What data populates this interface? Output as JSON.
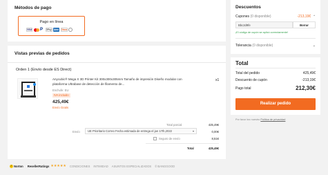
{
  "payment": {
    "title": "Métodos de pago",
    "option_label": "Pago en línea",
    "logos": [
      "VISA",
      "MC",
      "PayPal",
      "GPay",
      "Amex",
      "Discover",
      "Diners"
    ]
  },
  "orders": {
    "title": "Vistas previas de pedidos",
    "order_label": "Orden 1 (Envío desde ES Direct)",
    "product": {
      "name": "Anycubic® Mega X 3D Printer Kit 300x300x305mm Tamaño de impresión Diseño modular con plataforma Ultrabase de detección de filamento de...",
      "sku": "Enchufe: EU",
      "tag": "IVA incluido",
      "price": "425,49€",
      "shipping_note": "Envío Gratis",
      "qty": "x1"
    },
    "subtotal_label": "Total parcial",
    "subtotal_value": "425,49€",
    "shipping_label": "Envío",
    "shipping_method": "UE Prioritario Correo Fecha estimada de entrega el jan 17th,2022",
    "shipping_value": "0,00€",
    "insurance_label": "Seguro de envío",
    "insurance_value": "8,51€",
    "total_label": "Total",
    "total_value": "425,49€"
  },
  "discounts": {
    "title": "Descuentos",
    "coupon_label": "Cupones",
    "coupon_available": "(0 disponible)",
    "coupon_amount": "-213,19€",
    "coupon_code": "Bbc2d9fe",
    "remove_label": "Borrar",
    "coupon_success": "¡El código de cupón se aplicó correctamente!",
    "tolerance_label": "Tolerancia",
    "tolerance_available": "(0 disponible)"
  },
  "summary": {
    "title": "Total",
    "order_total_label": "Total del pedido",
    "order_total_value": "425,49€",
    "coupon_discount_label": "Descuento de cupón",
    "coupon_discount_value": "-213,19€",
    "paid_label": "Pago total",
    "paid_value": "212,30€",
    "button_label": "Realizar pedido",
    "privacy_prefix": "Por favor lea nuestro",
    "privacy_link": "Política de privacidad"
  },
  "footer": {
    "badge_brand": "Norton",
    "ratings_label": "ResellerRatings",
    "stars": "★★★★★",
    "links": [
      "CONDICIONES",
      "INTIMIDAD",
      "ASUNTOS ESPECIALIZADOS",
      "© BANGGOOD"
    ]
  },
  "colors": {
    "accent": "#f26b21",
    "background": "#f2f2f2",
    "success": "#2e9e47"
  }
}
